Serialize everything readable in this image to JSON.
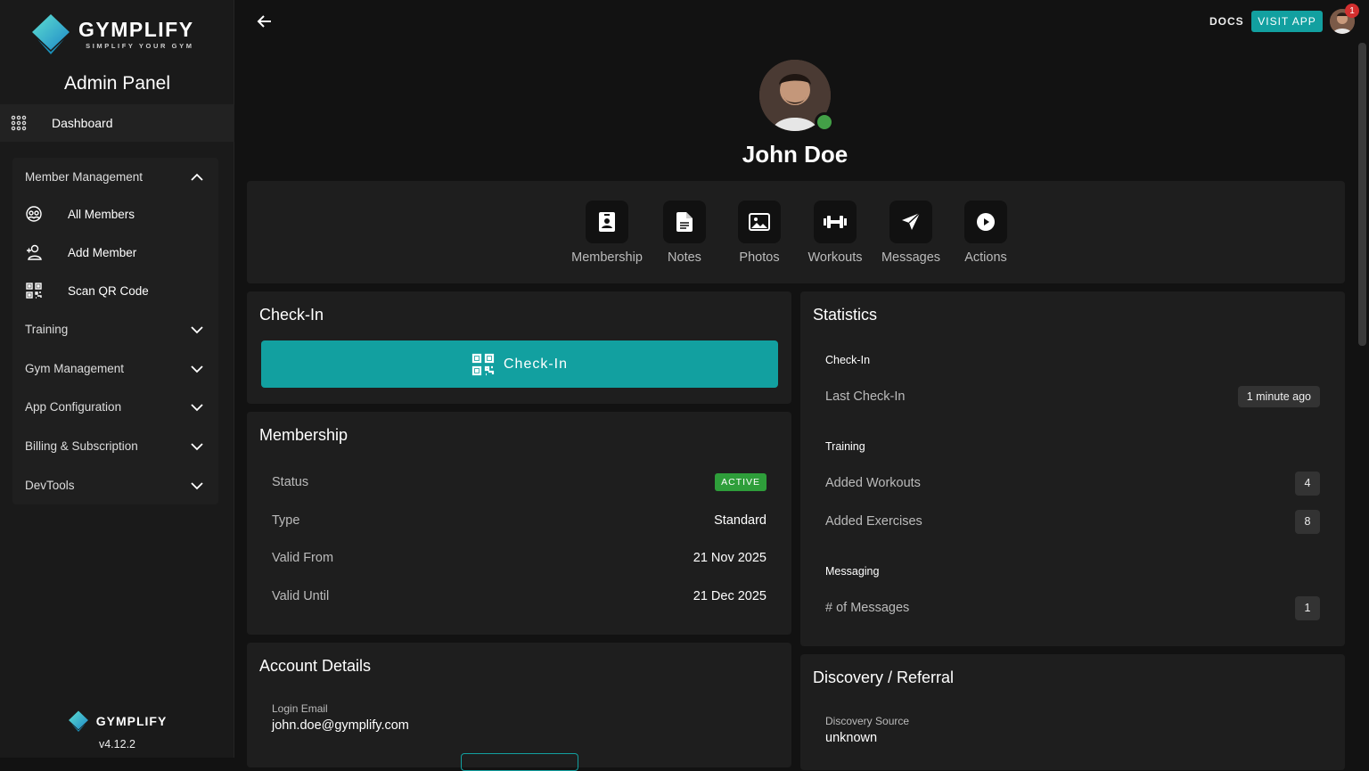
{
  "sidebar": {
    "brand_name": "GYMPLIFY",
    "brand_tagline": "SIMPLIFY YOUR GYM",
    "panel_title": "Admin Panel",
    "dashboard_label": "Dashboard",
    "member_management": {
      "label": "Member Management",
      "items": [
        {
          "label": "All Members",
          "icon": "members-icon"
        },
        {
          "label": "Add Member",
          "icon": "add-user-icon"
        },
        {
          "label": "Scan QR Code",
          "icon": "qr-code-icon"
        }
      ]
    },
    "sections": [
      "Training",
      "Gym Management",
      "App Configuration",
      "Billing & Subscription",
      "DevTools"
    ],
    "footer_brand": "GYMPLIFY",
    "version": "v4.12.2"
  },
  "topbar": {
    "docs_label": "DOCS",
    "visit_label": "VISIT APP",
    "notification_count": "1"
  },
  "profile": {
    "name": "John Doe",
    "online": true
  },
  "actions": [
    {
      "label": "Membership",
      "icon": "id-badge-icon"
    },
    {
      "label": "Notes",
      "icon": "document-icon"
    },
    {
      "label": "Photos",
      "icon": "photo-icon"
    },
    {
      "label": "Workouts",
      "icon": "dumbbell-icon"
    },
    {
      "label": "Messages",
      "icon": "send-icon"
    },
    {
      "label": "Actions",
      "icon": "play-icon"
    }
  ],
  "checkin": {
    "title": "Check-In",
    "button_label": "Check-In"
  },
  "membership": {
    "title": "Membership",
    "status_label": "Status",
    "status_value": "ACTIVE",
    "type_label": "Type",
    "type_value": "Standard",
    "valid_from_label": "Valid From",
    "valid_from_value": "21 Nov 2025",
    "valid_until_label": "Valid Until",
    "valid_until_value": "21 Dec 2025"
  },
  "account": {
    "title": "Account Details",
    "login_email_label": "Login Email",
    "login_email_value": "john.doe@gymplify.com"
  },
  "statistics": {
    "title": "Statistics",
    "checkin_section": "Check-In",
    "last_checkin_label": "Last Check-In",
    "last_checkin_value": "1 minute ago",
    "training_section": "Training",
    "added_workouts_label": "Added Workouts",
    "added_workouts_value": "4",
    "added_exercises_label": "Added Exercises",
    "added_exercises_value": "8",
    "messaging_section": "Messaging",
    "messages_label": "# of Messages",
    "messages_value": "1"
  },
  "discovery": {
    "title": "Discovery / Referral",
    "source_label": "Discovery Source",
    "source_value": "unknown"
  },
  "colors": {
    "accent": "#12a0a0",
    "active": "#2e9e3a",
    "online": "#43a047",
    "notification": "#d32f2f"
  }
}
